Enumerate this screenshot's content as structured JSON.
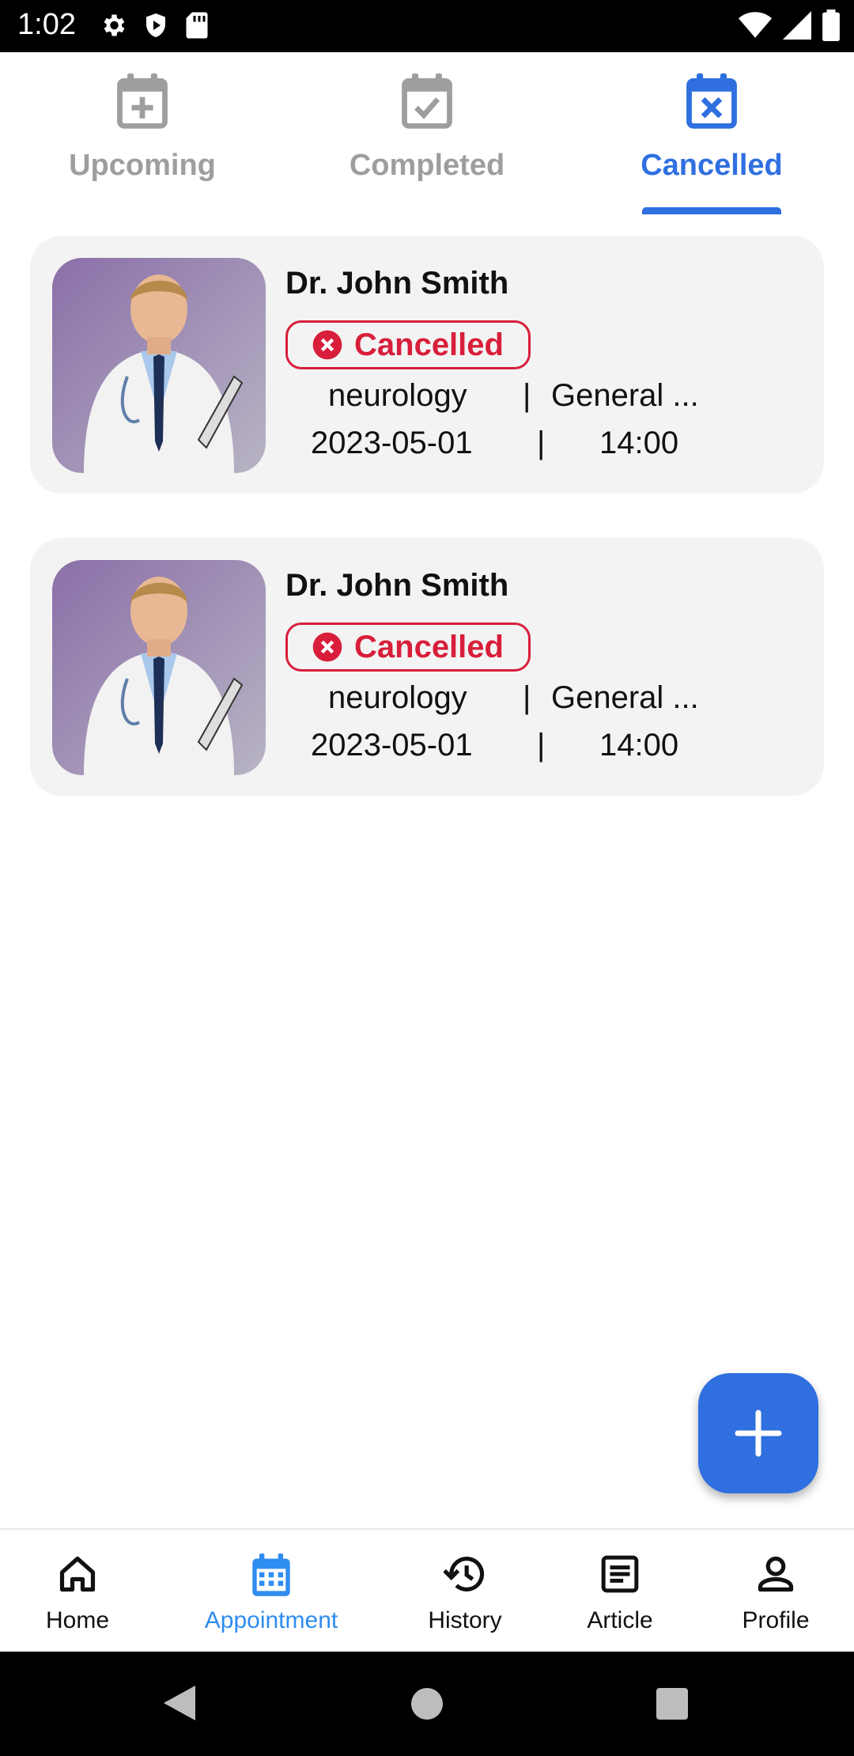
{
  "status_bar": {
    "time": "1:02",
    "icons_left": [
      "gear-icon",
      "shield-play-icon",
      "sd-card-icon"
    ],
    "icons_right": [
      "wifi-icon",
      "signal-icon",
      "battery-icon"
    ]
  },
  "tabs": [
    {
      "label": "Upcoming",
      "icon": "calendar-plus-icon",
      "active": false
    },
    {
      "label": "Completed",
      "icon": "calendar-check-icon",
      "active": false
    },
    {
      "label": "Cancelled",
      "icon": "calendar-x-icon",
      "active": true
    }
  ],
  "appointments": [
    {
      "doctor": "Dr. John Smith",
      "status": "Cancelled",
      "specialty": "neurology",
      "separator": "|",
      "category": "General ...",
      "date": "2023-05-01",
      "time": "14:00"
    },
    {
      "doctor": "Dr. John Smith",
      "status": "Cancelled",
      "specialty": "neurology",
      "separator": "|",
      "category": "General ...",
      "date": "2023-05-01",
      "time": "14:00"
    }
  ],
  "fab": {
    "icon": "plus-icon"
  },
  "bottom_nav": [
    {
      "label": "Home",
      "icon": "home-icon",
      "active": false
    },
    {
      "label": "Appointment",
      "icon": "calendar-icon",
      "active": true
    },
    {
      "label": "History",
      "icon": "history-icon",
      "active": false
    },
    {
      "label": "Article",
      "icon": "article-icon",
      "active": false
    },
    {
      "label": "Profile",
      "icon": "profile-icon",
      "active": false
    }
  ],
  "colors": {
    "accent": "#2f6fe0",
    "cancelled": "#d81e3a",
    "card_bg": "#f3f3f3"
  }
}
